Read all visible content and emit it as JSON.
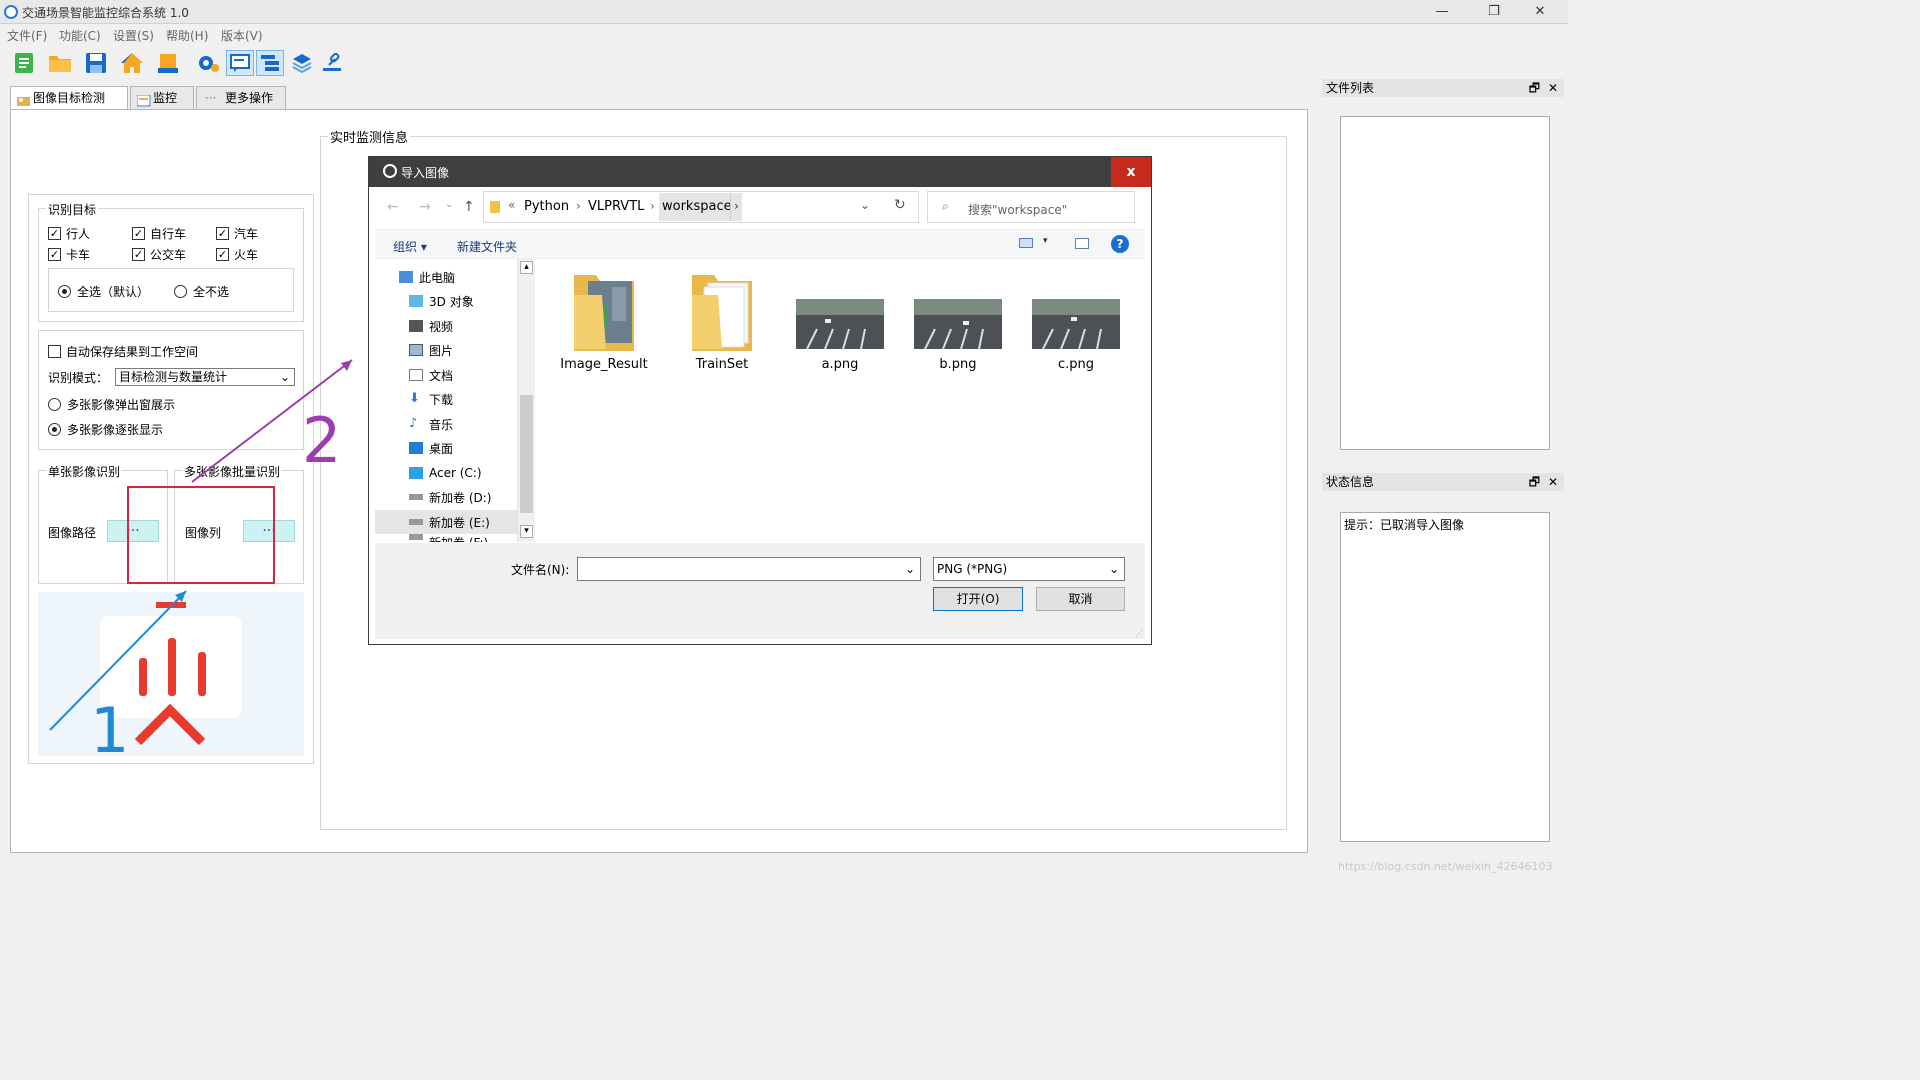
{
  "app": {
    "title": "交通场景智能监控综合系统 1.0",
    "min": "—",
    "restore": "❐",
    "close": "✕"
  },
  "menu": [
    "文件(F)",
    "功能(C)",
    "设置(S)",
    "帮助(H)",
    "版本(V)"
  ],
  "toolbar_icons": [
    "new-icon",
    "open-folder-icon",
    "save-icon",
    "home-icon",
    "export-icon",
    "settings-gear-icon",
    "chat-icon",
    "tree-icon",
    "layers-icon",
    "link-icon"
  ],
  "tabs": [
    "图像目标检测",
    "监控",
    "更多操作"
  ],
  "left": {
    "targets_title": "识别目标",
    "targets": [
      "行人",
      "自行车",
      "汽车",
      "卡车",
      "公交车",
      "火车"
    ],
    "select_all": "全选（默认）",
    "select_none": "全不选",
    "auto_save": "自动保存结果到工作空间",
    "mode_label": "识别模式：",
    "mode_value": "目标检测与数量统计",
    "multi_popup": "多张影像弹出窗展示",
    "multi_seq": "多张影像逐张显示",
    "single_title": "单张影像识别",
    "batch_title": "多张影像批量识别",
    "image_path": "图像路径",
    "image_list": "图像列",
    "dots": "···"
  },
  "monitor_title": "实时监测信息",
  "annotations": {
    "one": "1",
    "two": "2"
  },
  "dock": {
    "files_title": "文件列表",
    "status_title": "状态信息",
    "status_text": "提示：已取消导入图像",
    "float": "🗗",
    "close": "✕"
  },
  "dialog": {
    "title": "导入图像",
    "close": "x",
    "path": [
      "«",
      "Python",
      "VLPRVTL",
      "workspace"
    ],
    "search_placeholder": "搜索\"workspace\"",
    "organize": "组织 ▾",
    "new_folder": "新建文件夹",
    "nav": [
      "此电脑",
      "3D 对象",
      "视频",
      "图片",
      "文档",
      "下载",
      "音乐",
      "桌面",
      "Acer (C:)",
      "新加卷 (D:)",
      "新加卷 (E:)",
      "新加卷 (F:)"
    ],
    "files": [
      "Image_Result",
      "TrainSet",
      "a.png",
      "b.png",
      "c.png"
    ],
    "filename_label": "文件名(N):",
    "filename_value": "",
    "filetype": "PNG (*PNG)",
    "open": "打开(O)",
    "cancel": "取消"
  },
  "watermark": "https://blog.csdn.net/weixin_42646103"
}
